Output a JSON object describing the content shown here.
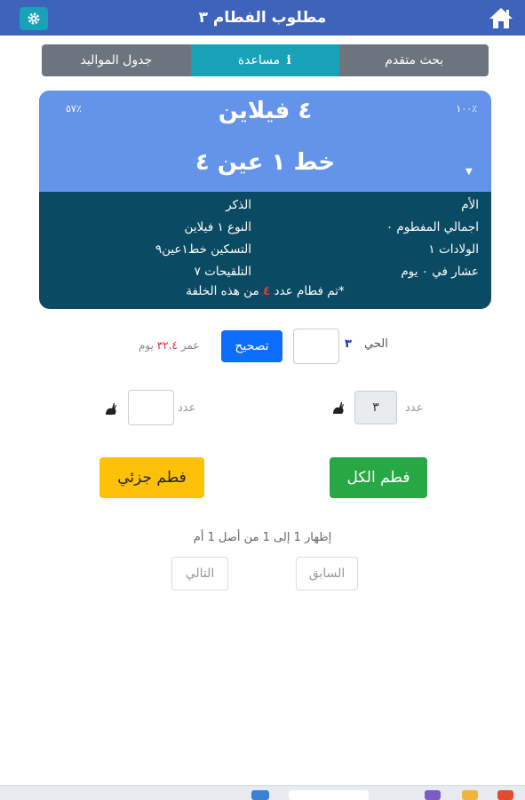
{
  "header": {
    "title": "مطلوب الفطام ٣",
    "home_icon": "home-icon",
    "settings_icon": "gear-icon"
  },
  "tabs": [
    {
      "label": "بحث متقدم",
      "active": false
    },
    {
      "label": "مساعدة",
      "active": true,
      "icon": "info-icon"
    },
    {
      "label": "جدول المواليد",
      "active": false
    }
  ],
  "card": {
    "percent_right": "١٠٠٪",
    "percent_left": "٥٧٪",
    "name": "٤ فيلاين",
    "line": "خط ١ عين ٤",
    "right_col": [
      "الأم",
      "اجمالي المفطوم ٠",
      "الولادات ١",
      "عشار في ٠ يوم"
    ],
    "left_col": [
      "الذكر",
      "النوع ١ فيلاين",
      "التسكين خط١عين٩",
      "التلقيحات ٧"
    ],
    "note_prefix": "*تم فطام عدد",
    "note_number": "٤",
    "note_suffix": "من هذه الخلفة",
    "colors": {
      "top": "#6494ea",
      "bottom": "#0b4a63",
      "note_number": "#e53935"
    }
  },
  "age_row": {
    "hay_label": "الحي",
    "hay_number": "٣",
    "hay_input_value": "",
    "fix_button": "تصحيح",
    "age_prefix": "عمر",
    "age_value": "٣٢.٤",
    "age_unit": "يوم"
  },
  "counts": {
    "left_label": "عدد",
    "left_value": "",
    "right_label": "عدد",
    "right_value": "٣",
    "animal_icon": "rabbit-icon"
  },
  "actions": {
    "wean_all": "فطم الكل",
    "wean_partial": "فطم جزئي"
  },
  "pagination": {
    "summary": "إظهار 1 إلى 1 من أصل 1 أم",
    "previous": "السابق",
    "next": "التالي"
  }
}
